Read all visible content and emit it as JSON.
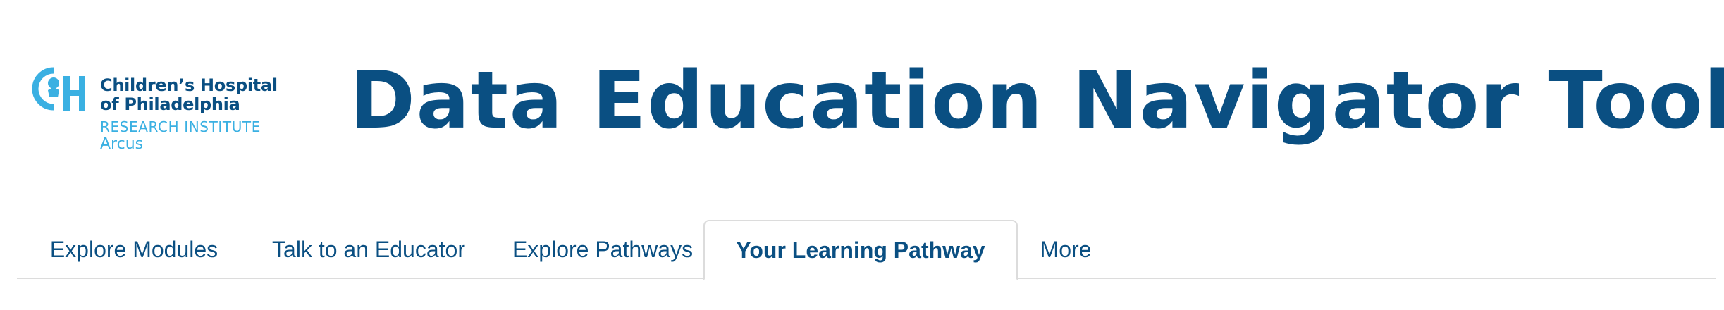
{
  "header": {
    "logo": {
      "line1": "Children’s Hospital",
      "line2": "of Philadelphia",
      "line3": "RESEARCH INSTITUTE",
      "line4": "Arcus",
      "mark_icon": "chop-ch-logo-icon",
      "colors": {
        "dark_blue": "#0a4f82",
        "light_blue": "#3ab0e2"
      }
    },
    "title": "Data Education Navigator Tool"
  },
  "nav": {
    "tabs": [
      {
        "label": "Explore Modules",
        "active": false
      },
      {
        "label": "Talk to an Educator",
        "active": false
      },
      {
        "label": "Explore Pathways",
        "active": false
      },
      {
        "label": "Your Learning Pathway",
        "active": true
      },
      {
        "label": "More",
        "active": false
      }
    ]
  },
  "colors": {
    "brand": "#0a4f82",
    "accent": "#3ab0e2",
    "divider": "#dcdcdc",
    "background": "#ffffff"
  }
}
